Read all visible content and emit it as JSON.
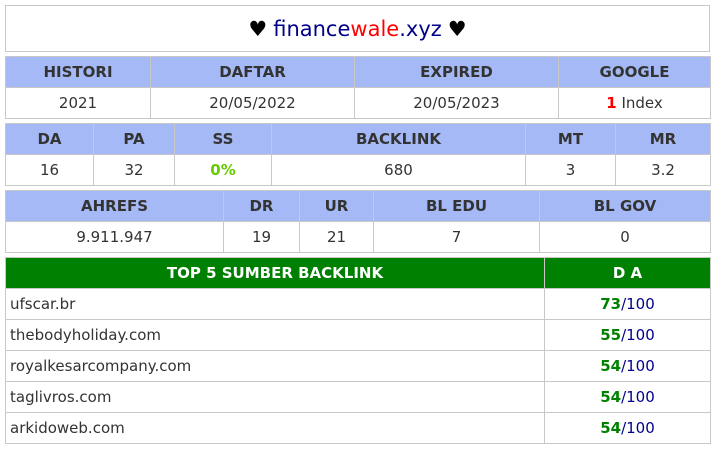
{
  "header": {
    "heart": "♥",
    "domain_part1": "finance",
    "domain_part2": "wale",
    "domain_part3": ".xyz"
  },
  "table1": {
    "headers": [
      "HISTORI",
      "DAFTAR",
      "EXPIRED",
      "GOOGLE"
    ],
    "values": {
      "histori": "2021",
      "daftar": "20/05/2022",
      "expired": "20/05/2023",
      "google_count": "1",
      "google_label": " Index"
    }
  },
  "table2": {
    "headers": [
      "DA",
      "PA",
      "SS",
      "BACKLINK",
      "MT",
      "MR"
    ],
    "values": [
      "16",
      "32",
      "0%",
      "680",
      "3",
      "3.2"
    ]
  },
  "table3": {
    "headers": [
      "AHREFS",
      "DR",
      "UR",
      "BL EDU",
      "BL GOV"
    ],
    "values": [
      "9.911.947",
      "19",
      "21",
      "7",
      "0"
    ]
  },
  "table4": {
    "headers": [
      "TOP 5 SUMBER BACKLINK",
      "D A"
    ],
    "rows": [
      {
        "site": "ufscar.br",
        "da": "73",
        "sep": "/",
        "max": "100"
      },
      {
        "site": "thebodyholiday.com",
        "da": "55",
        "sep": "/",
        "max": "100"
      },
      {
        "site": "royalkesarcompany.com",
        "da": "54",
        "sep": "/",
        "max": "100"
      },
      {
        "site": "taglivros.com",
        "da": "54",
        "sep": "/",
        "max": "100"
      },
      {
        "site": "arkidoweb.com",
        "da": "54",
        "sep": "/",
        "max": "100"
      }
    ]
  },
  "colors": {
    "header_blue": "#a4b9f5",
    "header_green": "#008000",
    "domain_navy": "#00008b",
    "domain_red": "#ff0000"
  }
}
